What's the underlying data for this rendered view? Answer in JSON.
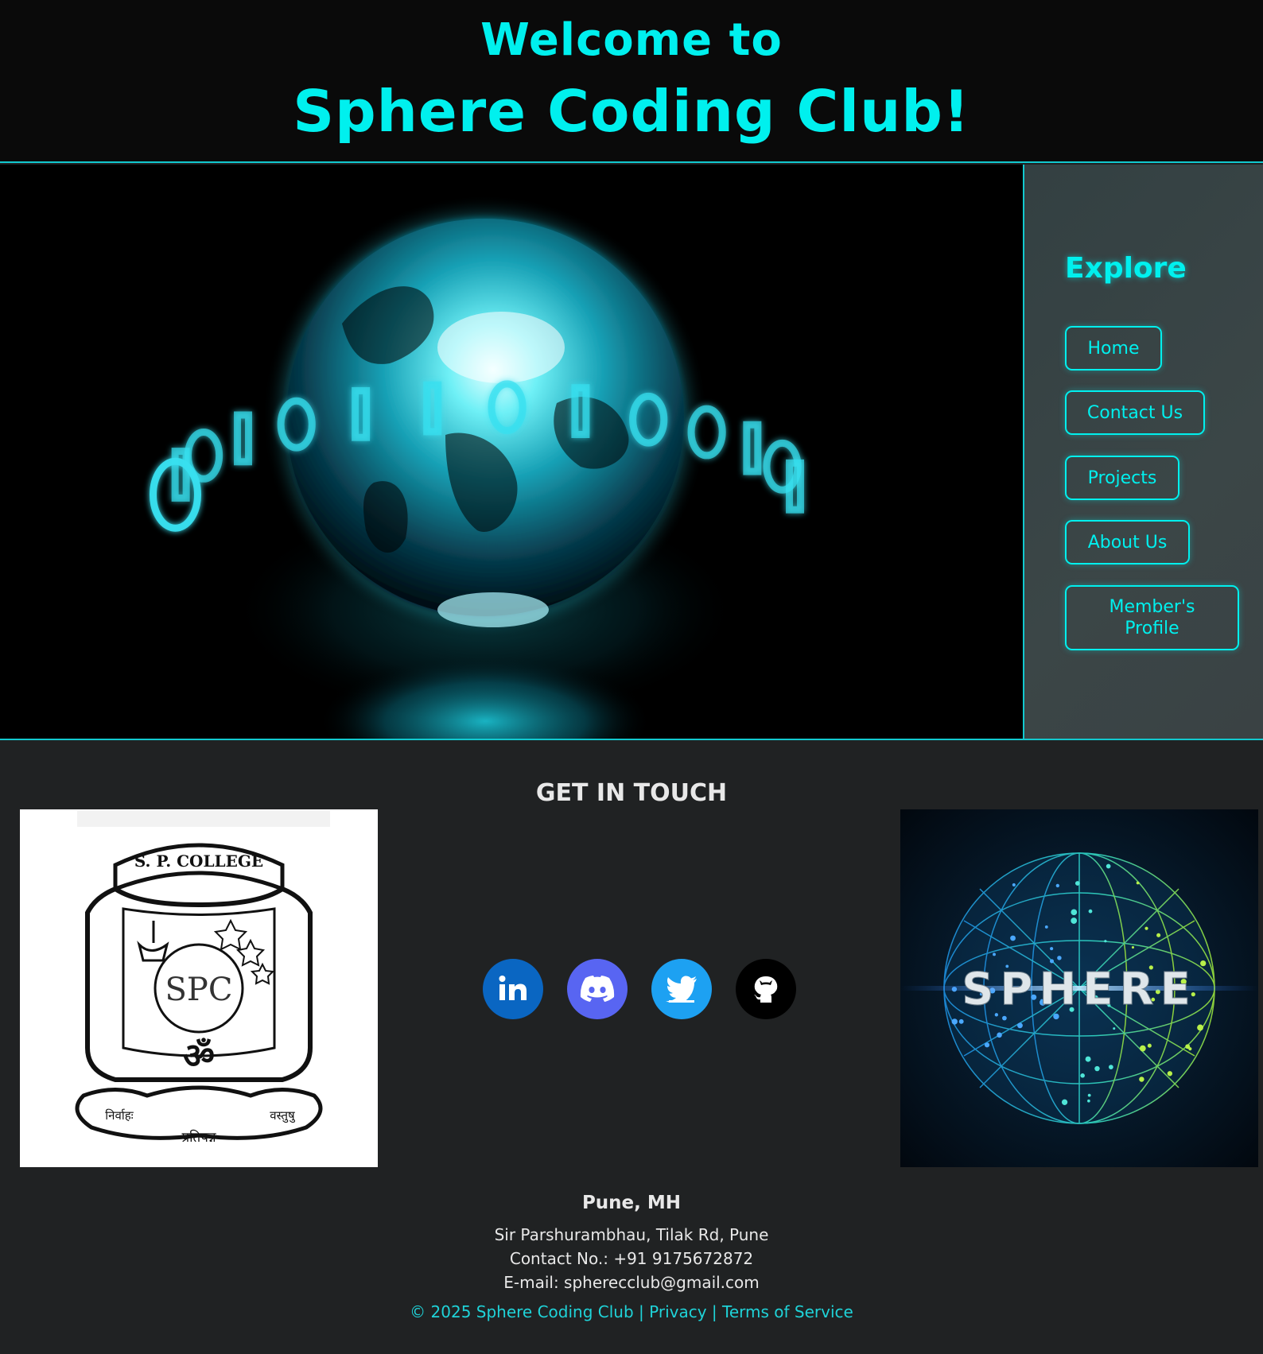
{
  "header": {
    "welcome": "Welcome to",
    "club_name": "Sphere Coding Club!"
  },
  "hero": {
    "image": "globe-binary-illustration",
    "binary_digits": [
      "0",
      "1",
      "0",
      "1",
      "0",
      "1",
      "1",
      "0",
      "1",
      "0",
      "0",
      "1",
      "0",
      "1"
    ]
  },
  "sidebar": {
    "title": "Explore",
    "items": [
      {
        "label": "Home"
      },
      {
        "label": "Contact Us"
      },
      {
        "label": "Projects"
      },
      {
        "label": "About Us"
      },
      {
        "label": "Member's Profile"
      }
    ]
  },
  "footer": {
    "title": "GET IN TOUCH",
    "college_logo": {
      "top_text": "S. P. COLLEGE",
      "monogram": "SPC",
      "symbol": "ॐ",
      "scroll_left": "निर्वाहः",
      "scroll_right": "वस्तुषु",
      "scroll_bottom": "प्रतिपन्न"
    },
    "sphere_logo_text": "SPHERE",
    "socials": [
      {
        "name": "LinkedIn",
        "icon": "linkedin-icon",
        "color": "#0a66c2"
      },
      {
        "name": "Discord",
        "icon": "discord-icon",
        "color": "#5865f2"
      },
      {
        "name": "Twitter",
        "icon": "twitter-icon",
        "color": "#1da1f2"
      },
      {
        "name": "GitHub",
        "icon": "github-icon",
        "color": "#000000"
      }
    ],
    "city": "Pune, MH",
    "address": "Sir Parshurambhau, Tilak Rd, Pune",
    "contact": "Contact No.: +91 9175672872",
    "email": "E-mail: spherecclub@gmail.com",
    "copyright": "© 2025 Sphere Coding Club",
    "separator": "|",
    "privacy": "Privacy",
    "terms": "Terms of Service"
  },
  "colors": {
    "accent": "#00f0ee",
    "header_bg": "#0a0a0a",
    "page_bg": "#202223",
    "sidebar_bg": "#3a4446"
  }
}
